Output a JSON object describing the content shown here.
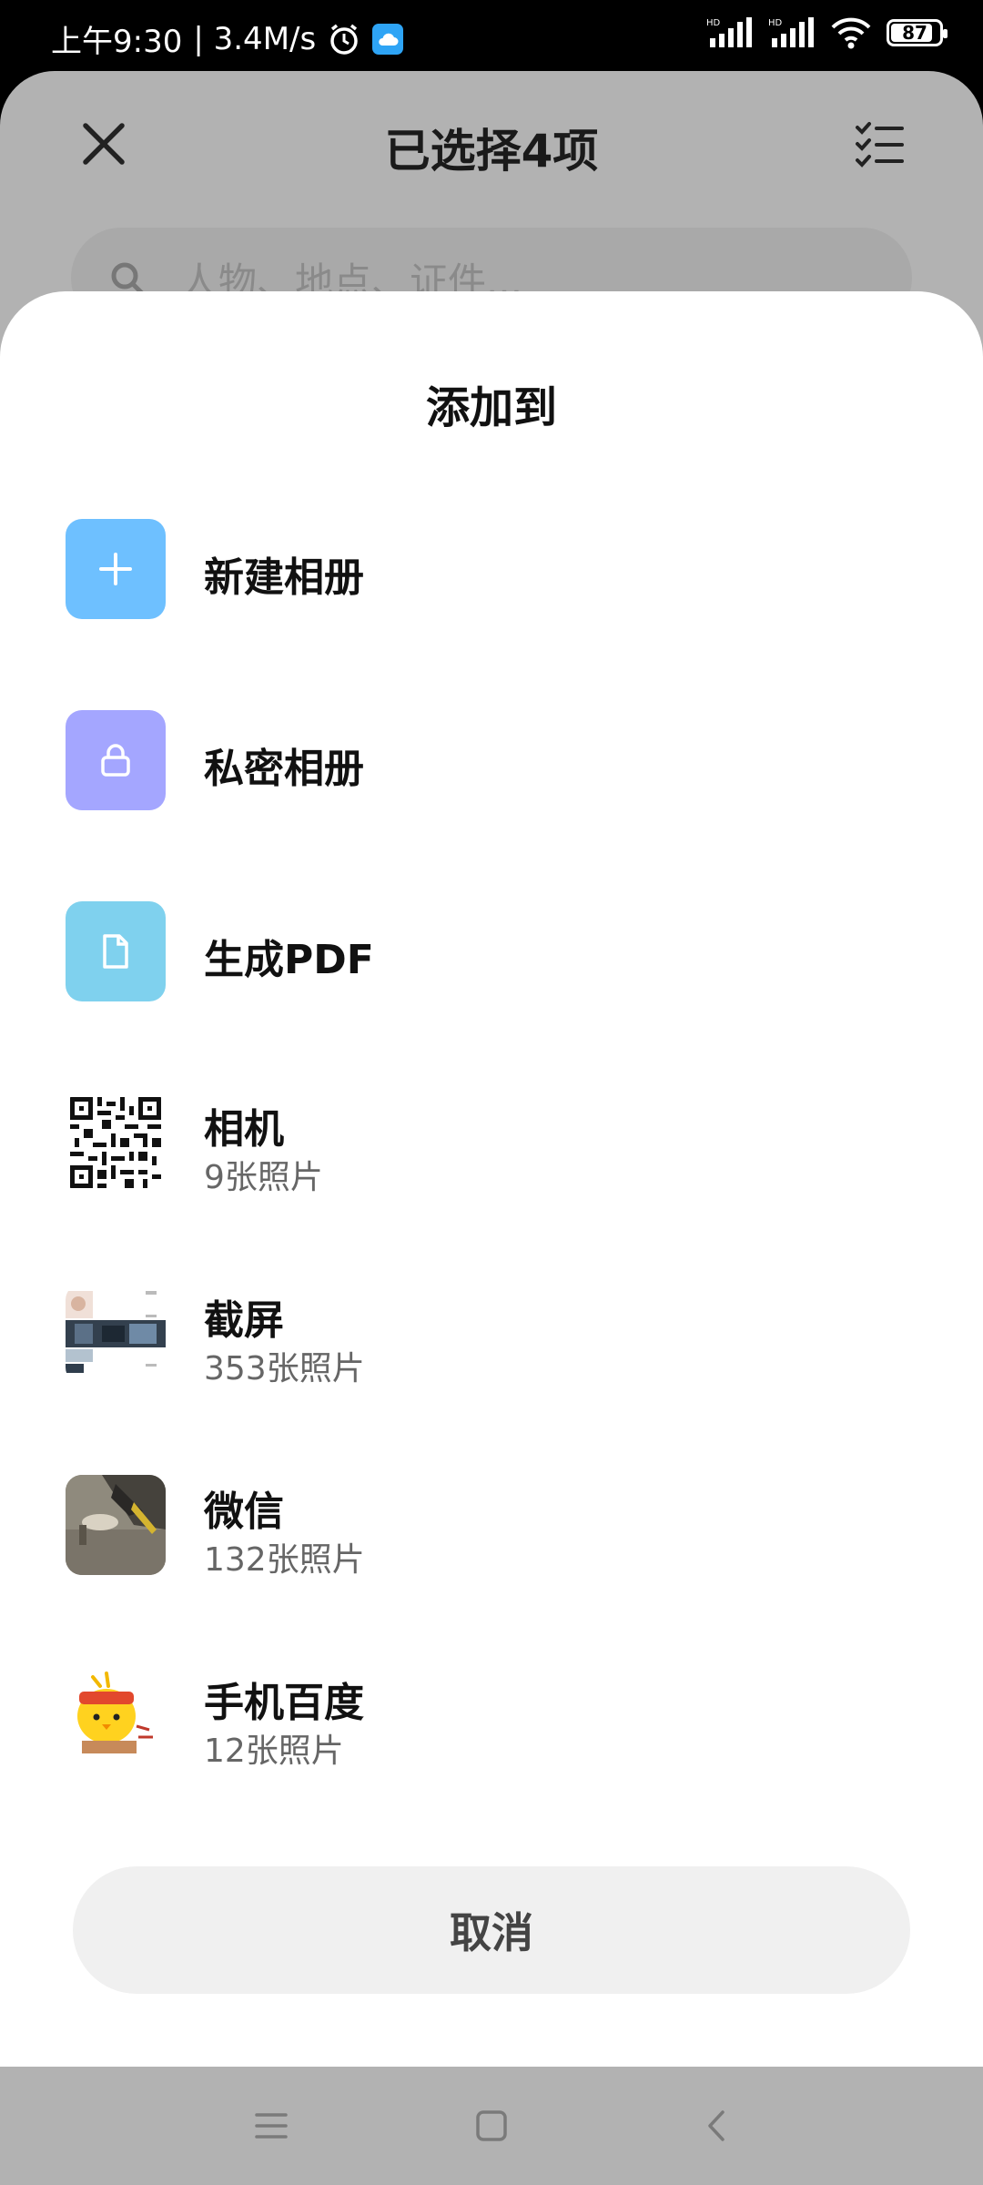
{
  "status_bar": {
    "time": "上午9:30",
    "speed": "| 3.4M/s",
    "battery": "87",
    "icons": [
      "alarm-icon",
      "cloud-icon",
      "hd-signal-icon",
      "hd-signal-icon",
      "wifi-icon",
      "battery-icon"
    ]
  },
  "header": {
    "title": "已选择4项",
    "close_icon": "close-icon",
    "select_all_icon": "checklist-icon"
  },
  "search": {
    "placeholder": "人物、地点、证件..."
  },
  "sheet": {
    "title": "添加到",
    "items": [
      {
        "label": "新建相册",
        "icon": "plus-icon",
        "color": "#6ec0ff"
      },
      {
        "label": "私密相册",
        "icon": "lock-icon",
        "color": "#a4a6ff"
      },
      {
        "label": "生成PDF",
        "icon": "document-icon",
        "color": "#7fd1ee"
      },
      {
        "label": "相机",
        "count": "9张照片",
        "icon": "qr-thumbnail"
      },
      {
        "label": "截屏",
        "count": "353张照片",
        "icon": "screenshot-thumbnail"
      },
      {
        "label": "微信",
        "count": "132张照片",
        "icon": "photo-thumbnail"
      },
      {
        "label": "手机百度",
        "count": "12张照片",
        "icon": "sticker-thumbnail"
      }
    ],
    "cancel": "取消"
  },
  "navbar": {
    "icons": [
      "menu-icon",
      "home-icon",
      "back-icon"
    ]
  }
}
